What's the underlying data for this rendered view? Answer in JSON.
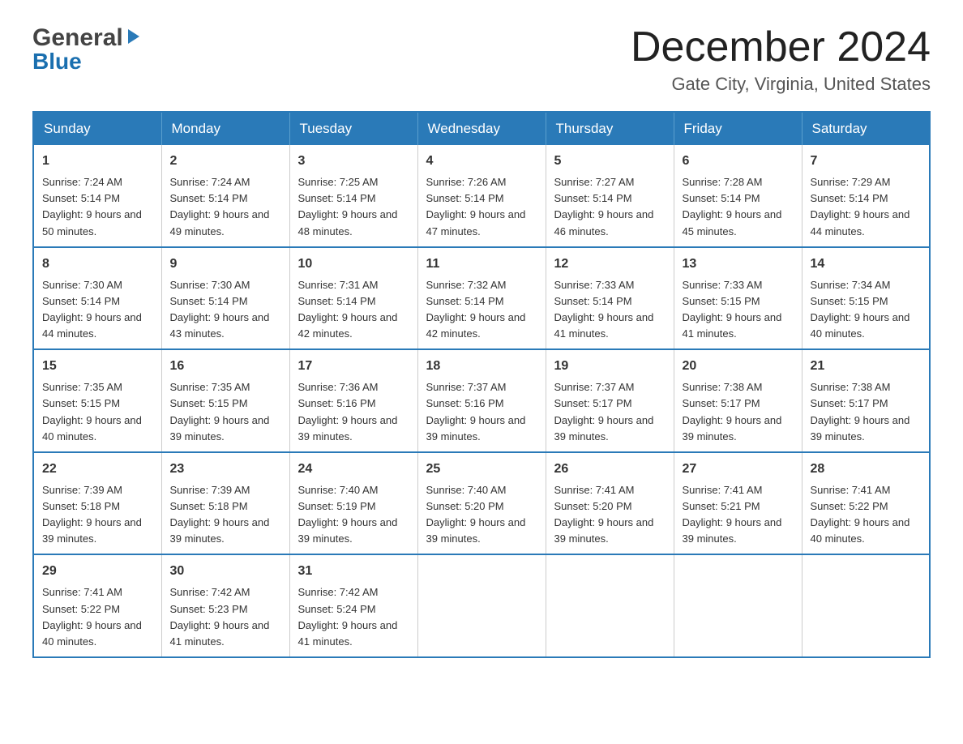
{
  "header": {
    "logo_general": "General",
    "logo_blue": "Blue",
    "month_title": "December 2024",
    "location": "Gate City, Virginia, United States"
  },
  "days_of_week": [
    "Sunday",
    "Monday",
    "Tuesday",
    "Wednesday",
    "Thursday",
    "Friday",
    "Saturday"
  ],
  "weeks": [
    [
      {
        "day": "1",
        "sunrise": "7:24 AM",
        "sunset": "5:14 PM",
        "daylight": "9 hours and 50 minutes."
      },
      {
        "day": "2",
        "sunrise": "7:24 AM",
        "sunset": "5:14 PM",
        "daylight": "9 hours and 49 minutes."
      },
      {
        "day": "3",
        "sunrise": "7:25 AM",
        "sunset": "5:14 PM",
        "daylight": "9 hours and 48 minutes."
      },
      {
        "day": "4",
        "sunrise": "7:26 AM",
        "sunset": "5:14 PM",
        "daylight": "9 hours and 47 minutes."
      },
      {
        "day": "5",
        "sunrise": "7:27 AM",
        "sunset": "5:14 PM",
        "daylight": "9 hours and 46 minutes."
      },
      {
        "day": "6",
        "sunrise": "7:28 AM",
        "sunset": "5:14 PM",
        "daylight": "9 hours and 45 minutes."
      },
      {
        "day": "7",
        "sunrise": "7:29 AM",
        "sunset": "5:14 PM",
        "daylight": "9 hours and 44 minutes."
      }
    ],
    [
      {
        "day": "8",
        "sunrise": "7:30 AM",
        "sunset": "5:14 PM",
        "daylight": "9 hours and 44 minutes."
      },
      {
        "day": "9",
        "sunrise": "7:30 AM",
        "sunset": "5:14 PM",
        "daylight": "9 hours and 43 minutes."
      },
      {
        "day": "10",
        "sunrise": "7:31 AM",
        "sunset": "5:14 PM",
        "daylight": "9 hours and 42 minutes."
      },
      {
        "day": "11",
        "sunrise": "7:32 AM",
        "sunset": "5:14 PM",
        "daylight": "9 hours and 42 minutes."
      },
      {
        "day": "12",
        "sunrise": "7:33 AM",
        "sunset": "5:14 PM",
        "daylight": "9 hours and 41 minutes."
      },
      {
        "day": "13",
        "sunrise": "7:33 AM",
        "sunset": "5:15 PM",
        "daylight": "9 hours and 41 minutes."
      },
      {
        "day": "14",
        "sunrise": "7:34 AM",
        "sunset": "5:15 PM",
        "daylight": "9 hours and 40 minutes."
      }
    ],
    [
      {
        "day": "15",
        "sunrise": "7:35 AM",
        "sunset": "5:15 PM",
        "daylight": "9 hours and 40 minutes."
      },
      {
        "day": "16",
        "sunrise": "7:35 AM",
        "sunset": "5:15 PM",
        "daylight": "9 hours and 39 minutes."
      },
      {
        "day": "17",
        "sunrise": "7:36 AM",
        "sunset": "5:16 PM",
        "daylight": "9 hours and 39 minutes."
      },
      {
        "day": "18",
        "sunrise": "7:37 AM",
        "sunset": "5:16 PM",
        "daylight": "9 hours and 39 minutes."
      },
      {
        "day": "19",
        "sunrise": "7:37 AM",
        "sunset": "5:17 PM",
        "daylight": "9 hours and 39 minutes."
      },
      {
        "day": "20",
        "sunrise": "7:38 AM",
        "sunset": "5:17 PM",
        "daylight": "9 hours and 39 minutes."
      },
      {
        "day": "21",
        "sunrise": "7:38 AM",
        "sunset": "5:17 PM",
        "daylight": "9 hours and 39 minutes."
      }
    ],
    [
      {
        "day": "22",
        "sunrise": "7:39 AM",
        "sunset": "5:18 PM",
        "daylight": "9 hours and 39 minutes."
      },
      {
        "day": "23",
        "sunrise": "7:39 AM",
        "sunset": "5:18 PM",
        "daylight": "9 hours and 39 minutes."
      },
      {
        "day": "24",
        "sunrise": "7:40 AM",
        "sunset": "5:19 PM",
        "daylight": "9 hours and 39 minutes."
      },
      {
        "day": "25",
        "sunrise": "7:40 AM",
        "sunset": "5:20 PM",
        "daylight": "9 hours and 39 minutes."
      },
      {
        "day": "26",
        "sunrise": "7:41 AM",
        "sunset": "5:20 PM",
        "daylight": "9 hours and 39 minutes."
      },
      {
        "day": "27",
        "sunrise": "7:41 AM",
        "sunset": "5:21 PM",
        "daylight": "9 hours and 39 minutes."
      },
      {
        "day": "28",
        "sunrise": "7:41 AM",
        "sunset": "5:22 PM",
        "daylight": "9 hours and 40 minutes."
      }
    ],
    [
      {
        "day": "29",
        "sunrise": "7:41 AM",
        "sunset": "5:22 PM",
        "daylight": "9 hours and 40 minutes."
      },
      {
        "day": "30",
        "sunrise": "7:42 AM",
        "sunset": "5:23 PM",
        "daylight": "9 hours and 41 minutes."
      },
      {
        "day": "31",
        "sunrise": "7:42 AM",
        "sunset": "5:24 PM",
        "daylight": "9 hours and 41 minutes."
      },
      null,
      null,
      null,
      null
    ]
  ],
  "labels": {
    "sunrise": "Sunrise:",
    "sunset": "Sunset:",
    "daylight": "Daylight:"
  }
}
